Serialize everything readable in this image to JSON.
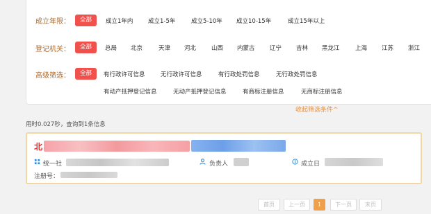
{
  "filters": {
    "years": {
      "label": "成立年限：",
      "options": [
        "全部",
        "成立1年内",
        "成立1-5年",
        "成立5-10年",
        "成立10-15年",
        "成立15年以上"
      ]
    },
    "registry": {
      "label": "登记机关：",
      "options": [
        "全部",
        "总局",
        "北京",
        "天津",
        "河北",
        "山西",
        "内蒙古",
        "辽宁",
        "吉林",
        "黑龙江",
        "上海",
        "江苏",
        "浙江"
      ]
    },
    "advanced": {
      "label": "高级筛选：",
      "options_row1": [
        "全部",
        "有行政许可信息",
        "无行政许可信息",
        "有行政处罚信息",
        "无行政处罚信息"
      ],
      "options_row2": [
        "有动产抵押登记信息",
        "无动产抵押登记信息",
        "有商标注册信息",
        "无商标注册信息"
      ]
    },
    "collapse_label": "收起筛选条件^"
  },
  "summary": "用时0.027秒，查询到1条信息",
  "result": {
    "title_prefix": "北",
    "credit_code_label": "统一社",
    "legal_rep_label": "负责人",
    "founded_label": "成立日",
    "reg_no_label": "注册号："
  },
  "pager": {
    "first": "首页",
    "prev": "上一页",
    "current": "1",
    "next": "下一页",
    "last": "末页"
  },
  "colors": {
    "accent_red": "#f0514c",
    "label_brown": "#b06b2d",
    "link_orange": "#e8913f",
    "card_border": "#f2d7a5",
    "pager_active": "#f0a04b"
  }
}
